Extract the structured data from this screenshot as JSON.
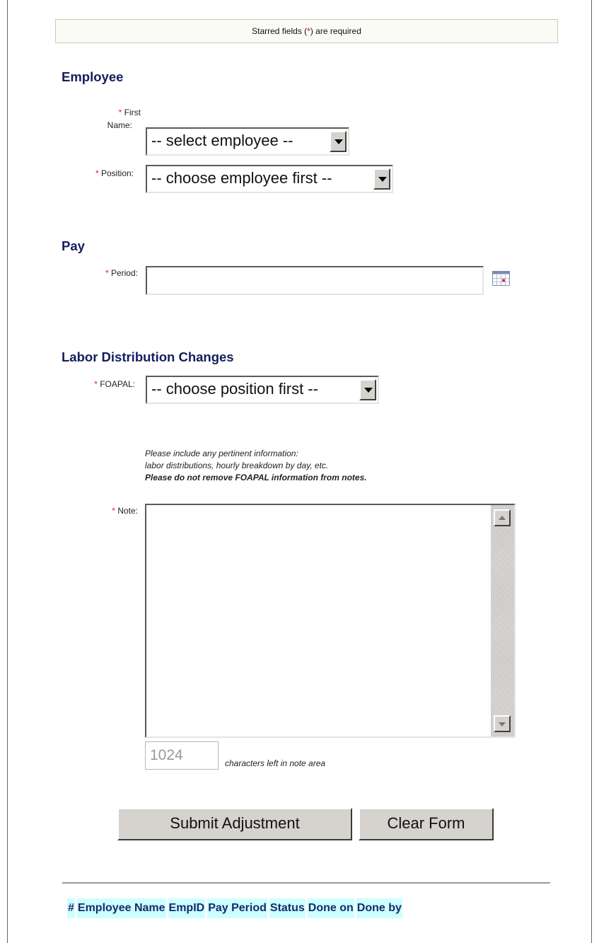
{
  "notice": {
    "before": "Starred fields (",
    "star": "*",
    "after": ") are required"
  },
  "employee": {
    "title": "Employee",
    "first_name": {
      "star": "*",
      "label_line1": "First",
      "label_line2": "Name:",
      "value": "-- select employee --"
    },
    "position": {
      "star": "*",
      "label": "Position:",
      "value": "-- choose employee first --"
    }
  },
  "pay": {
    "title": "Pay",
    "period": {
      "star": "*",
      "label": "Period:",
      "value": ""
    },
    "calendar_icon": "calendar-icon"
  },
  "labor": {
    "title": "Labor Distribution Changes",
    "foapal": {
      "star": "*",
      "label": "FOAPAL:",
      "value": "-- choose position first --"
    },
    "help_line1": "Please include any pertinent information:",
    "help_line2": "labor distributions, hourly breakdown by day, etc.",
    "help_line3": "Please do not remove FOAPAL information from notes.",
    "note": {
      "star": "*",
      "label": "Note:",
      "value": ""
    },
    "chars_left": "1024",
    "chars_left_label": "characters left in note area"
  },
  "buttons": {
    "submit": "Submit Adjustment",
    "clear": "Clear Form"
  },
  "table": {
    "columns": [
      "#",
      "Employee Name",
      "EmpID",
      "Pay Period",
      "Status",
      "Done on",
      "Done by"
    ]
  },
  "colors": {
    "heading": "#131e5c",
    "required": "#e02020",
    "table_header_bg": "#ccffff"
  }
}
